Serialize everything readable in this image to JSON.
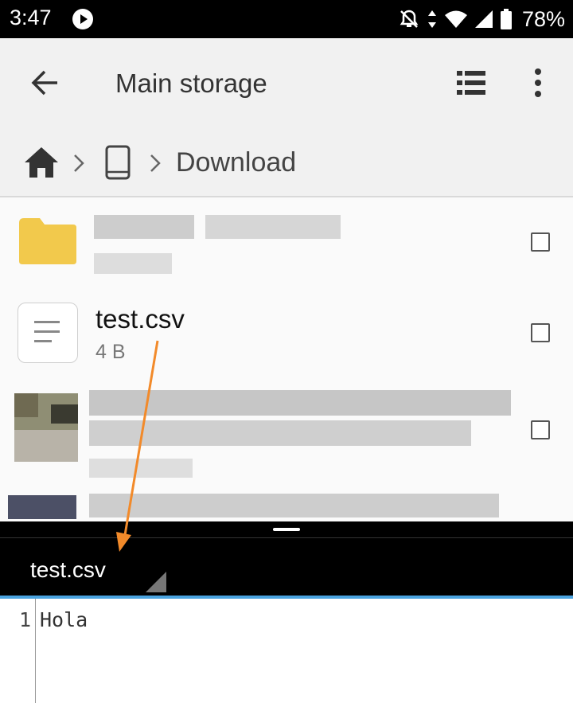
{
  "status_bar": {
    "time": "3:47",
    "battery": "78%",
    "icons": [
      "play-icon",
      "notifications-off-icon",
      "data-arrows-icon",
      "wifi-icon",
      "signal-icon",
      "battery-icon"
    ]
  },
  "app_bar": {
    "title": "Main storage",
    "icons": [
      "back-arrow-icon",
      "list-view-icon",
      "more-vert-icon"
    ]
  },
  "breadcrumb": {
    "items": [
      "home-icon",
      "phone-icon",
      "Download"
    ],
    "current": "Download"
  },
  "file_list": {
    "items": [
      {
        "type": "folder",
        "name": "",
        "detail": "",
        "checked": false
      },
      {
        "type": "file",
        "name": "test.csv",
        "size": "4 B",
        "checked": false
      },
      {
        "type": "image",
        "name": "",
        "detail": "",
        "checked": false
      }
    ]
  },
  "editor": {
    "tab_label": "test.csv",
    "lines": [
      {
        "number": "1",
        "text": "Hola"
      }
    ]
  },
  "colors": {
    "status_bar": "#000000",
    "app_bar": "#f1f1f1",
    "folder": "#f2c94c",
    "tab_accent": "#4aa3df",
    "annotation_arrow": "#f28a2a"
  }
}
